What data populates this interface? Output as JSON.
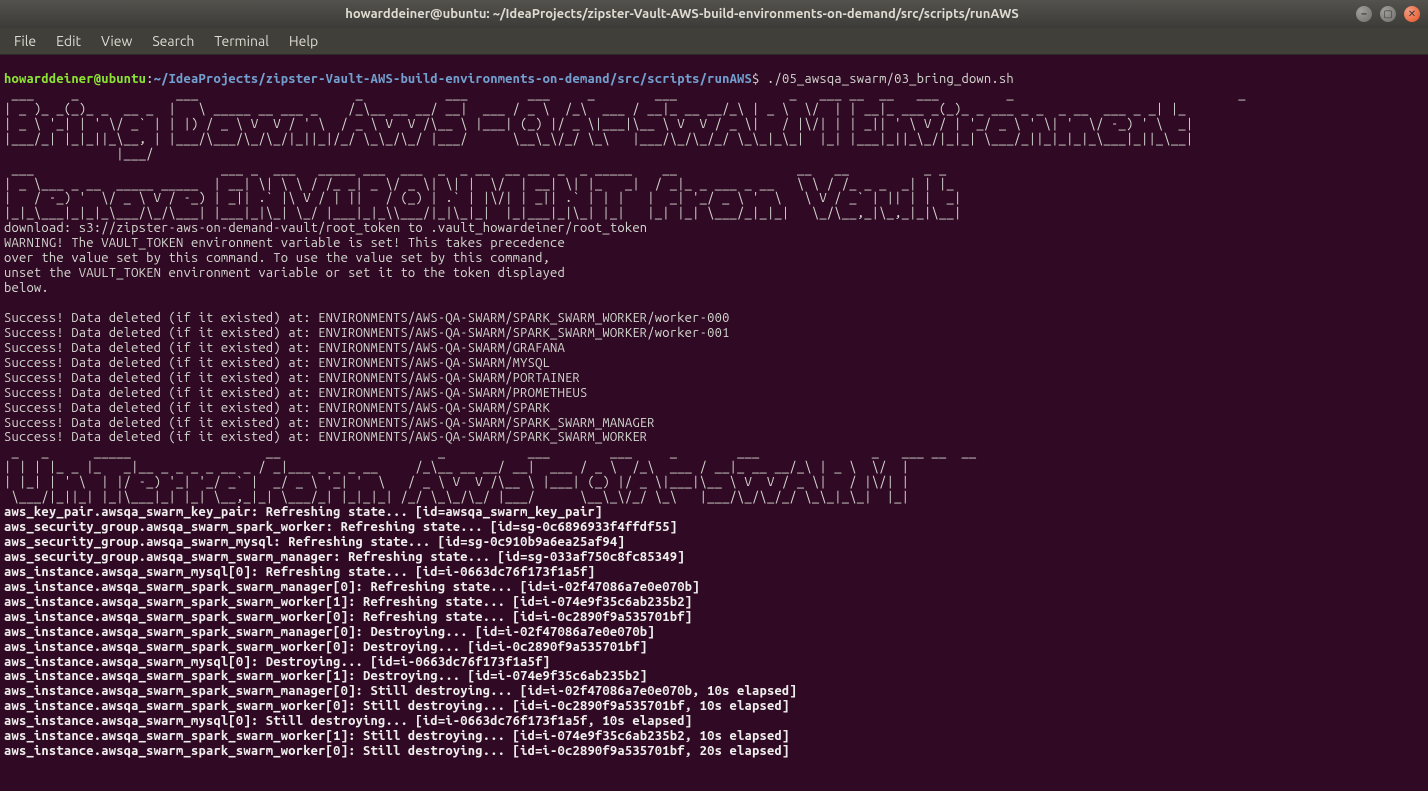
{
  "window": {
    "title": "howarddeiner@ubuntu: ~/IdeaProjects/zipster-Vault-AWS-build-environments-on-demand/src/scripts/runAWS"
  },
  "menu": {
    "items": [
      "File",
      "Edit",
      "View",
      "Search",
      "Terminal",
      "Help"
    ]
  },
  "prompt": {
    "user_host": "howarddeiner@ubuntu",
    "separator": ":",
    "path": "~/IdeaProjects/zipster-Vault-AWS-build-environments-on-demand/src/scripts/runAWS",
    "dollar": "$",
    "command": "./05_awsqa_swarm/03_bring_down.sh"
  },
  "ascii": {
    "banner1": " ___     _             ___                     _           ___        ___     _        ___               _   ___ __  __   ___         _                              _   \n| _ )_ _(_)_ _  __ _  |   \\ _____ __ ___ _    /_\\__ __ __/ __|  ___ / _ \\  /_\\  ___ / __|_ __ __/_\\ | _ \\  \\/  | | __|_ ___ _(_)_ _ ___ _ _  _ __  ___ _ _| |_ \n| _ \\ '_| | ' \\/ _` | | |) / _ \\ V  V / ' \\  / _ \\ V  V /\\__ \\ |___| (_) |/ _ \\|___|\\__ \\ V  V / _ \\|   / |\\/| | | _|| ' \\ V / | '_/ _ \\ ' \\| '  \\/ -_) ' \\  _|\n|___/_| |_|_||_\\__, | |___/\\___/\\_/\\_/|_||_|/_/ \\_\\_/\\_/ |___/      \\__\\_\\/_/ \\_\\   |___/\\_/\\_/_/ \\_\\_|_\\_|  |_| |___|_||_\\_/|_|_| \\___/_||_|_|_|_\\___|_||_\\__|\n               |___/                                                                                                                                           ",
    "banner2": " ___                         ___ _  ___   _____ ___  ___  _  _ __  __ ___ _  _ _____    __                __   __          _ _   \n| _ \\___ _ __  _____ _____  | __| \\| \\ \\ / /_ _| _ \\/ _ \\| \\| |  \\/  | __| \\| |_   _|  / _|_ _ ___ _ __   \\ \\ / /_ _ _  _| | |_ \n|   / -_) '  \\/ _ \\ V / -_) | _|| .` |\\ V / | ||   / (_) | .` | |\\/| | _|| .` | | |   |  _| '_/ _ \\ '  \\   \\ V / _` | || | |  _|\n|_|_\\___|_|_|_\\___/\\_/\\___| |___|_|\\_| \\_/ |___|_|_\\\\___/|_|\\_|_|  |_|___|_|\\_| |_|   |_| |_| \\___/_|_|_|   \\_/\\__,_|\\_,_|_|\\__|",
    "banner3": " _   _      _____                  __                     _           ___        ___     _        ___               _   ___ __  __ \n| | | |_ _ |_   _|__ _ _ _ _ __ _ / _|___ _ _ _ __     /_\\__ __ __/ __|  ___ / _ \\  /_\\  ___ / __|_ __ __/_\\ | _ \\  \\/  |\n| |_| | ' \\  | |/ -_) '_| '_/ _` |  _/ _ \\ '_| '  \\   / _ \\ V  V /\\__ \\ |___| (_) |/ _ \\|___|\\__ \\ V  V / _ \\|   / |\\/| |\n \\___/|_||_| |_|\\___|_| |_| \\__,_|_| \\___/_| |_|_|_| /_/ \\_\\_/\\_/ |___/      \\__\\_\\/_/ \\_\\   |___/\\_/\\_/_/ \\_\\_|_\\_|  |_|"
  },
  "warning_block": [
    "download: s3://zipster-aws-on-demand-vault/root_token to .vault_howardeiner/root_token",
    "WARNING! The VAULT_TOKEN environment variable is set! This takes precedence",
    "over the value set by this command. To use the value set by this command,",
    "unset the VAULT_TOKEN environment variable or set it to the token displayed",
    "below."
  ],
  "success_lines": [
    "Success! Data deleted (if it existed) at: ENVIRONMENTS/AWS-QA-SWARM/SPARK_SWARM_WORKER/worker-000",
    "Success! Data deleted (if it existed) at: ENVIRONMENTS/AWS-QA-SWARM/SPARK_SWARM_WORKER/worker-001",
    "Success! Data deleted (if it existed) at: ENVIRONMENTS/AWS-QA-SWARM/GRAFANA",
    "Success! Data deleted (if it existed) at: ENVIRONMENTS/AWS-QA-SWARM/MYSQL",
    "Success! Data deleted (if it existed) at: ENVIRONMENTS/AWS-QA-SWARM/PORTAINER",
    "Success! Data deleted (if it existed) at: ENVIRONMENTS/AWS-QA-SWARM/PROMETHEUS",
    "Success! Data deleted (if it existed) at: ENVIRONMENTS/AWS-QA-SWARM/SPARK",
    "Success! Data deleted (if it existed) at: ENVIRONMENTS/AWS-QA-SWARM/SPARK_SWARM_MANAGER",
    "Success! Data deleted (if it existed) at: ENVIRONMENTS/AWS-QA-SWARM/SPARK_SWARM_WORKER"
  ],
  "terraform_lines": [
    "aws_key_pair.awsqa_swarm_key_pair: Refreshing state... [id=awsqa_swarm_key_pair]",
    "aws_security_group.awsqa_swarm_spark_worker: Refreshing state... [id=sg-0c6896933f4ffdf55]",
    "aws_security_group.awsqa_swarm_mysql: Refreshing state... [id=sg-0c910b9a6ea25af94]",
    "aws_security_group.awsqa_swarm_swarm_manager: Refreshing state... [id=sg-033af750c8fc85349]",
    "aws_instance.awsqa_swarm_mysql[0]: Refreshing state... [id=i-0663dc76f173f1a5f]",
    "aws_instance.awsqa_swarm_spark_swarm_manager[0]: Refreshing state... [id=i-02f47086a7e0e070b]",
    "aws_instance.awsqa_swarm_spark_swarm_worker[1]: Refreshing state... [id=i-074e9f35c6ab235b2]",
    "aws_instance.awsqa_swarm_spark_swarm_worker[0]: Refreshing state... [id=i-0c2890f9a535701bf]",
    "aws_instance.awsqa_swarm_spark_swarm_manager[0]: Destroying... [id=i-02f47086a7e0e070b]",
    "aws_instance.awsqa_swarm_spark_swarm_worker[0]: Destroying... [id=i-0c2890f9a535701bf]",
    "aws_instance.awsqa_swarm_mysql[0]: Destroying... [id=i-0663dc76f173f1a5f]",
    "aws_instance.awsqa_swarm_spark_swarm_worker[1]: Destroying... [id=i-074e9f35c6ab235b2]",
    "aws_instance.awsqa_swarm_spark_swarm_manager[0]: Still destroying... [id=i-02f47086a7e0e070b, 10s elapsed]",
    "aws_instance.awsqa_swarm_spark_swarm_worker[0]: Still destroying... [id=i-0c2890f9a535701bf, 10s elapsed]",
    "aws_instance.awsqa_swarm_mysql[0]: Still destroying... [id=i-0663dc76f173f1a5f, 10s elapsed]",
    "aws_instance.awsqa_swarm_spark_swarm_worker[1]: Still destroying... [id=i-074e9f35c6ab235b2, 10s elapsed]",
    "aws_instance.awsqa_swarm_spark_swarm_worker[0]: Still destroying... [id=i-0c2890f9a535701bf, 20s elapsed]"
  ],
  "icons": {
    "minimize": "–",
    "maximize": "▢",
    "close": "✕"
  }
}
